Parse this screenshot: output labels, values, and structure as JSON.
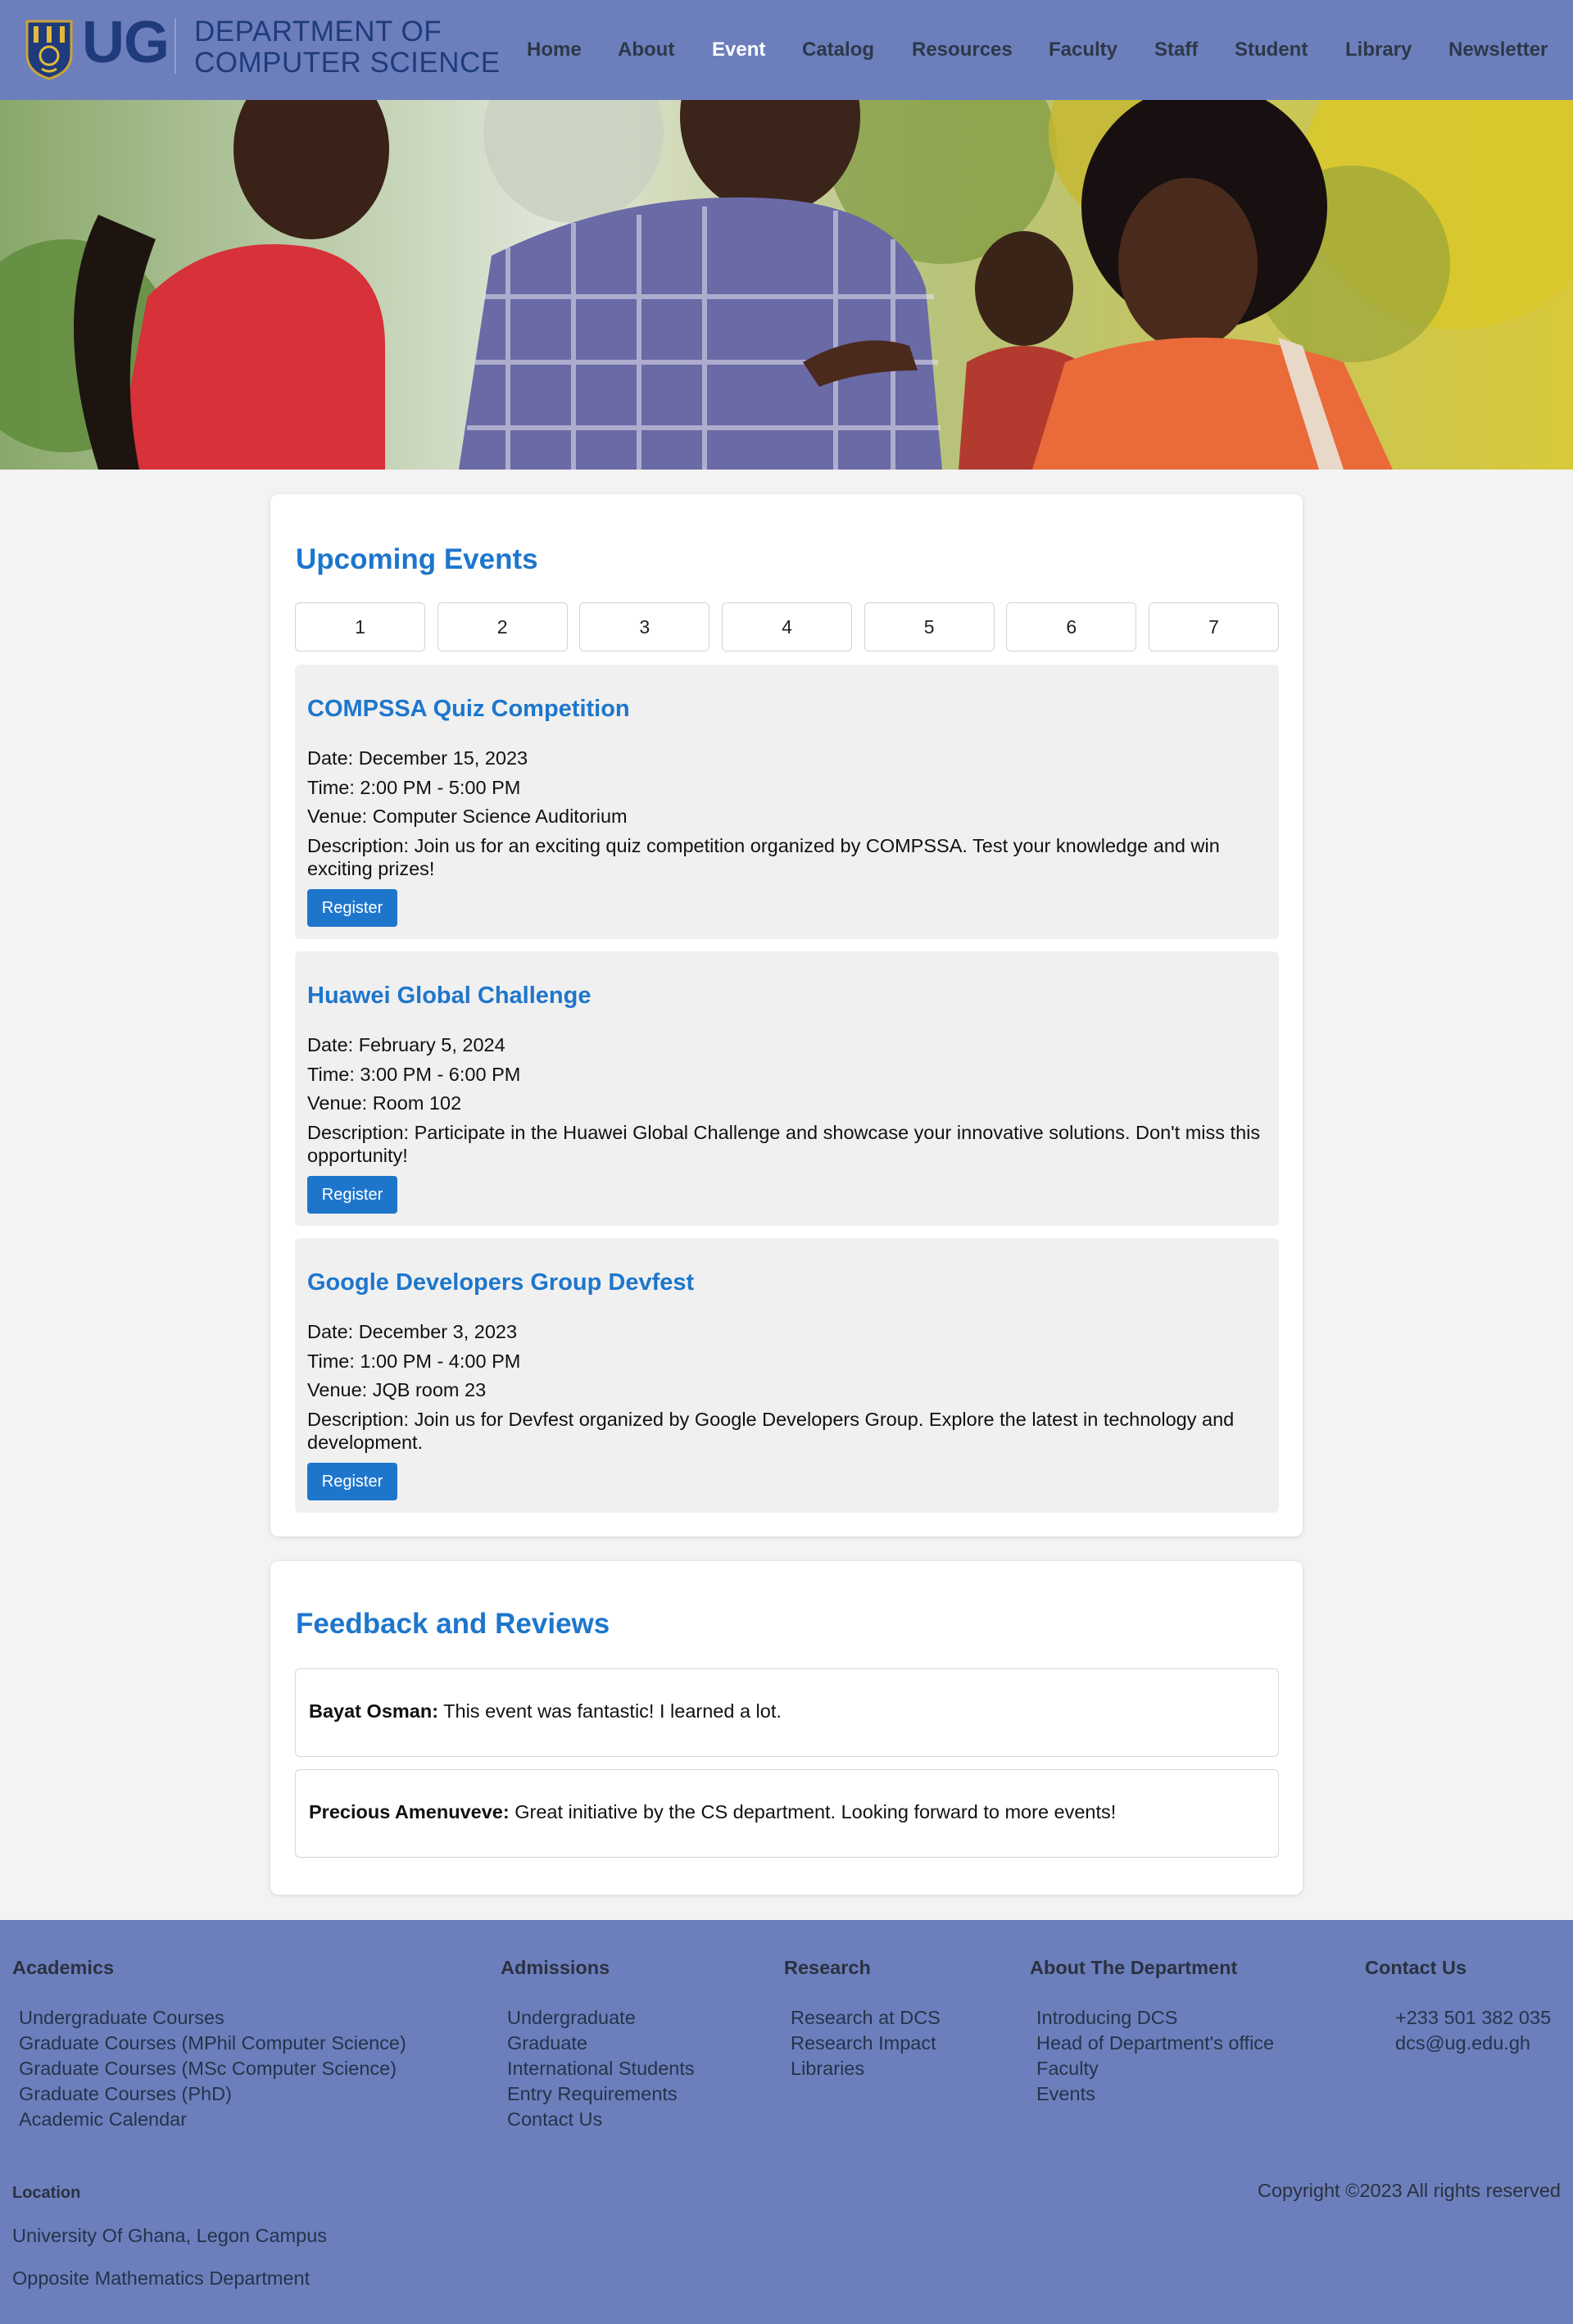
{
  "header": {
    "logo_text": "UG",
    "dept_line1": "DEPARTMENT OF",
    "dept_line2": "COMPUTER SCIENCE",
    "nav": [
      "Home",
      "About",
      "Event",
      "Catalog",
      "Resources",
      "Faculty",
      "Staff",
      "Student",
      "Library",
      "Newsletter"
    ],
    "active_nav": "Event"
  },
  "events_section": {
    "title": "Upcoming Events",
    "tabs": [
      "1",
      "2",
      "3",
      "4",
      "5",
      "6",
      "7"
    ],
    "events": [
      {
        "title": "COMPSSA Quiz Competition",
        "date": "Date: December 15, 2023",
        "time": "Time: 2:00 PM - 5:00 PM",
        "venue": "Venue: Computer Science Auditorium",
        "description": "Description: Join us for an exciting quiz competition organized by COMPSSA. Test your knowledge and win exciting prizes!",
        "button": "Register"
      },
      {
        "title": "Huawei Global Challenge",
        "date": "Date: February 5, 2024",
        "time": "Time: 3:00 PM - 6:00 PM",
        "venue": "Venue: Room 102",
        "description": "Description: Participate in the Huawei Global Challenge and showcase your innovative solutions. Don't miss this opportunity!",
        "button": "Register"
      },
      {
        "title": "Google Developers Group Devfest",
        "date": "Date: December 3, 2023",
        "time": "Time: 1:00 PM - 4:00 PM",
        "venue": "Venue: JQB room 23",
        "description": "Description: Join us for Devfest organized by Google Developers Group. Explore the latest in technology and development.",
        "button": "Register"
      }
    ]
  },
  "feedback_section": {
    "title": "Feedback and Reviews",
    "reviews": [
      {
        "name": "Bayat Osman:",
        "text": "This event was fantastic! I learned a lot."
      },
      {
        "name": "Precious Amenuveve:",
        "text": "Great initiative by the CS department. Looking forward to more events!"
      }
    ]
  },
  "footer": {
    "columns": [
      {
        "heading": "Academics",
        "links": [
          "Undergraduate Courses",
          "Graduate Courses (MPhil Computer Science)",
          "Graduate Courses (MSc Computer Science)",
          "Graduate Courses (PhD)",
          "Academic Calendar"
        ]
      },
      {
        "heading": "Admissions",
        "links": [
          "Undergraduate",
          "Graduate",
          "International Students",
          "Entry Requirements",
          "Contact Us"
        ]
      },
      {
        "heading": "Research",
        "links": [
          "Research at DCS",
          "Research Impact",
          "Libraries"
        ]
      },
      {
        "heading": "About The Department",
        "links": [
          "Introducing DCS",
          "Head of Department's office",
          "Faculty",
          "Events"
        ]
      },
      {
        "heading": "Contact Us",
        "links": [
          "+233 501 382 035",
          "dcs@ug.edu.gh"
        ]
      }
    ],
    "location_heading": "Location",
    "location_lines": [
      "University Of Ghana, Legon Campus",
      "Opposite Mathematics Department"
    ],
    "copyright": "Copyright ©2023 All rights reserved"
  },
  "colors": {
    "header_bg": "#6c7fbc",
    "accent": "#1e76cc",
    "page_bg": "#f3f3f3"
  }
}
